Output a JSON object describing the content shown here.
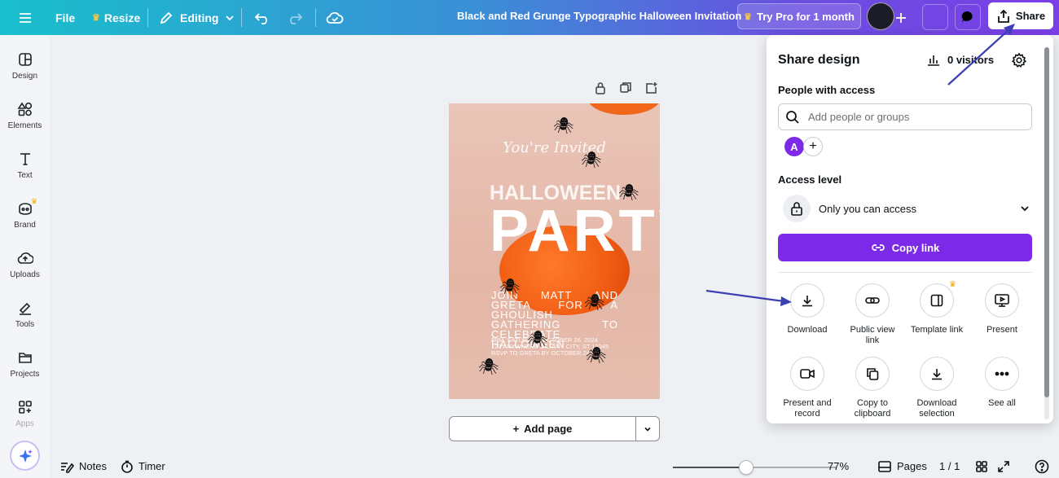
{
  "topbar": {
    "file": "File",
    "resize": "Resize",
    "editing": "Editing",
    "title": "Black and Red Grunge Typographic Halloween Invitation",
    "try_pro": "Try Pro for 1 month",
    "share": "Share"
  },
  "sidebar": {
    "items": [
      {
        "label": "Design",
        "icon": "design-icon"
      },
      {
        "label": "Elements",
        "icon": "elements-icon"
      },
      {
        "label": "Text",
        "icon": "text-icon"
      },
      {
        "label": "Brand",
        "icon": "brand-icon"
      },
      {
        "label": "Uploads",
        "icon": "uploads-icon"
      },
      {
        "label": "Tools",
        "icon": "tools-icon"
      },
      {
        "label": "Projects",
        "icon": "projects-icon"
      },
      {
        "label": "Apps",
        "icon": "apps-icon"
      }
    ]
  },
  "design": {
    "invited": "You're Invited",
    "halloween": "HALLOWEEN",
    "party": "PARTY",
    "join": "JOIN MATT AND GRETA FOR A GHOULISH GATHERING TO CELEBRATE HALLOWEEN",
    "details_1": "8PM, SATURDAY, OCTOBER 26, 2024",
    "details_2": "123 ANYWHERE ST., ANY CITY, ST 12345",
    "details_3": "RSVP TO GRETA BY OCTOBER 24"
  },
  "canvas": {
    "add_page": "Add page"
  },
  "bottombar": {
    "notes": "Notes",
    "timer": "Timer",
    "zoom": "77%",
    "zoom_level": 0.45,
    "pages": "Pages",
    "page_count": "1 / 1"
  },
  "share_panel": {
    "title": "Share design",
    "visitors": "0 visitors",
    "people_label": "People with access",
    "search_placeholder": "Add people or groups",
    "avatar_letter": "A",
    "access_label": "Access level",
    "access_value": "Only you can access",
    "copy_link": "Copy link",
    "options": [
      {
        "label": "Download",
        "icon": "download-icon"
      },
      {
        "label": "Public view link",
        "icon": "link-icon"
      },
      {
        "label": "Template link",
        "icon": "template-icon"
      },
      {
        "label": "Present",
        "icon": "present-icon"
      },
      {
        "label": "Present and record",
        "icon": "camera-icon"
      },
      {
        "label": "Copy to clipboard",
        "icon": "copy-icon"
      },
      {
        "label": "Download selection",
        "icon": "download-icon"
      },
      {
        "label": "See all",
        "icon": "more-icon"
      }
    ]
  },
  "colors": {
    "accent": "#7d2ae8",
    "annotation_arrow": "#3c3fb5"
  }
}
